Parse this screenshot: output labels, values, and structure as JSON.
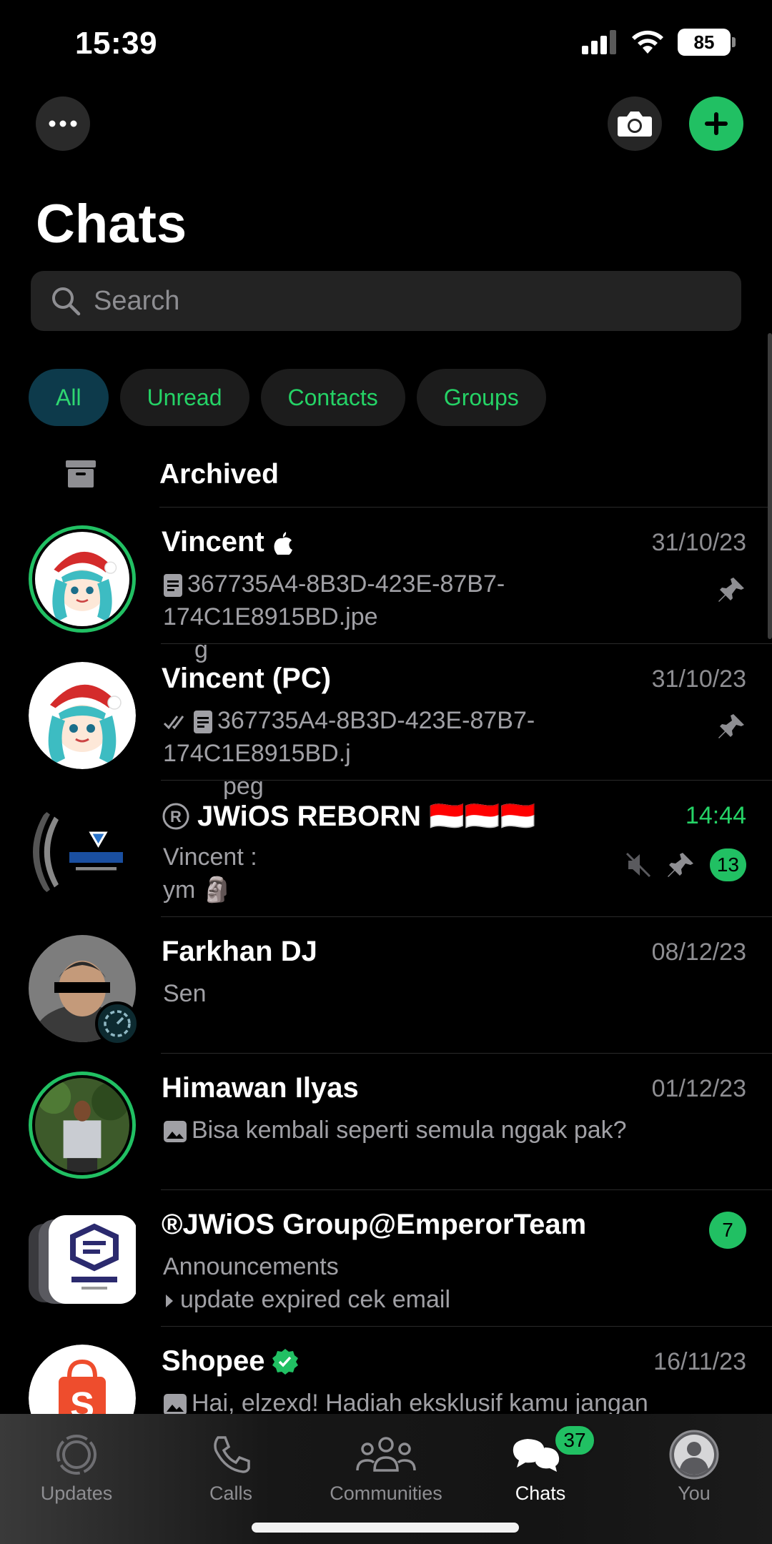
{
  "status_bar": {
    "time": "15:39",
    "battery": "85"
  },
  "header": {
    "title": "Chats"
  },
  "search": {
    "placeholder": "Search"
  },
  "filters": [
    "All",
    "Unread",
    "Contacts",
    "Groups"
  ],
  "archived": {
    "label": "Archived"
  },
  "chats": [
    {
      "name": "Vincent",
      "time": "31/10/23",
      "preview_line1": "367735A4-8B3D-423E-87B7-174C1E8915BD.jpe",
      "preview_line2": "g"
    },
    {
      "name": "Vincent (PC)",
      "time": "31/10/23",
      "preview_line1": "367735A4-8B3D-423E-87B7-174C1E8915BD.j",
      "preview_line2": "peg"
    },
    {
      "name": "JWiOS REBORN 🇮🇩🇮🇩🇮🇩",
      "time": "14:44",
      "preview_line1": "Vincent :",
      "preview_line2": "ym 🗿",
      "unread": "13"
    },
    {
      "name": "Farkhan DJ",
      "time": "08/12/23",
      "preview_line1": "Sen"
    },
    {
      "name": "Himawan Ilyas",
      "time": "01/12/23",
      "preview_line1": "Bisa kembali seperti semula nggak pak?"
    },
    {
      "name": "®JWiOS Group@EmperorTeam",
      "preview_line1": "Announcements",
      "preview_line2": "update expired cek email",
      "unread": "7"
    },
    {
      "name": "Shopee",
      "time": "16/11/23",
      "preview_line1": "Hai, elzexd! Hadiah eksklusif kamu jangan"
    }
  ],
  "tabs": [
    {
      "label": "Updates"
    },
    {
      "label": "Calls"
    },
    {
      "label": "Communities"
    },
    {
      "label": "Chats",
      "badge": "37"
    },
    {
      "label": "You"
    }
  ],
  "colors": {
    "accent": "#21c063",
    "background": "#000000"
  },
  "icons": [
    "more-icon",
    "camera-icon",
    "plus-icon",
    "search-icon",
    "archive-icon",
    "apple-icon",
    "document-icon",
    "double-check-icon",
    "image-icon",
    "pin-icon",
    "mute-icon",
    "verified-icon",
    "updates-icon",
    "calls-icon",
    "communities-icon",
    "chats-icon",
    "profile-icon"
  ]
}
